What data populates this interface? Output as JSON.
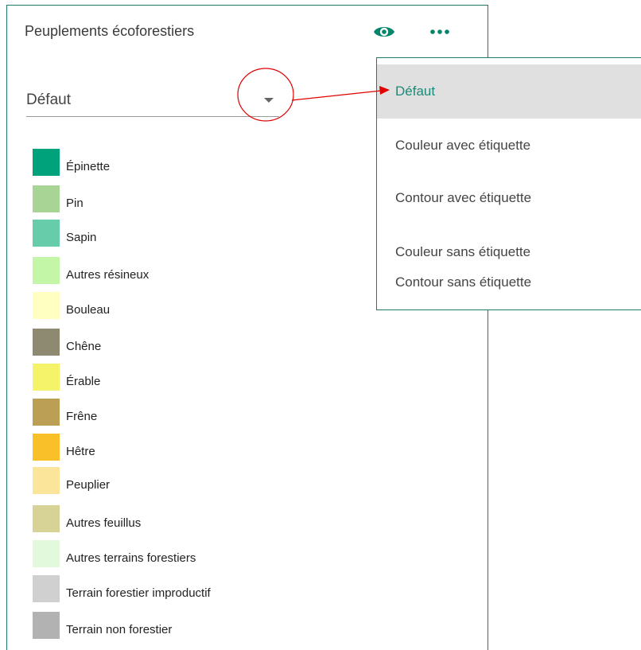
{
  "panel": {
    "title": "Peuplements écoforestiers",
    "accent_color": "#00846b",
    "icons": [
      "eye-icon",
      "more-icon"
    ]
  },
  "select": {
    "value": "Défaut"
  },
  "legend": {
    "items": [
      {
        "label": "Épinette",
        "color": "#00a27c"
      },
      {
        "label": "Pin",
        "color": "#a8d595"
      },
      {
        "label": "Sapin",
        "color": "#66ccaa"
      },
      {
        "label": "Autres résineux",
        "color": "#c3f6a6"
      },
      {
        "label": "Bouleau",
        "color": "#ffffc2"
      },
      {
        "label": "Chêne",
        "color": "#8e8a72"
      },
      {
        "label": "Érable",
        "color": "#f4f36a"
      },
      {
        "label": "Frêne",
        "color": "#bb9f55"
      },
      {
        "label": "Hêtre",
        "color": "#fac02a"
      },
      {
        "label": "Peuplier",
        "color": "#fae59b"
      },
      {
        "label": "Autres feuillus",
        "color": "#d7d397"
      },
      {
        "label": "Autres terrains forestiers",
        "color": "#e2f9dc"
      },
      {
        "label": "Terrain forestier improductif",
        "color": "#d0d0d0"
      },
      {
        "label": "Terrain non forestier",
        "color": "#b2b2b2"
      }
    ]
  },
  "dropdown": {
    "options": [
      {
        "label": "Défaut",
        "selected": true
      },
      {
        "label": "Couleur avec étiquette",
        "selected": false
      },
      {
        "label": "Contour avec étiquette",
        "selected": false
      },
      {
        "label": "Couleur sans étiquette",
        "selected": false
      },
      {
        "label": "Contour sans étiquette",
        "selected": false
      }
    ]
  },
  "annotation": {
    "color": "#e00000"
  }
}
